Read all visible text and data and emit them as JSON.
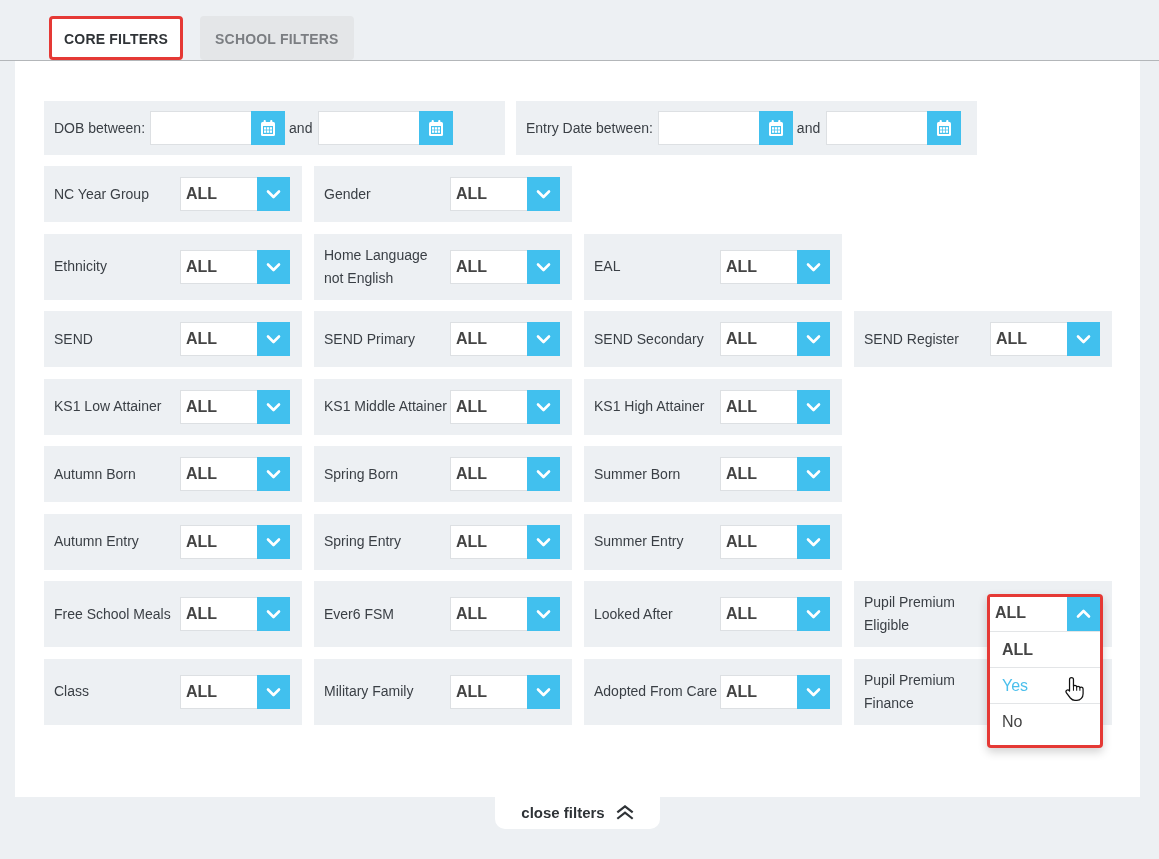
{
  "tabs": [
    {
      "label": "CORE FILTERS",
      "selected": true,
      "highlighted": true
    },
    {
      "label": "SCHOOL FILTERS",
      "selected": false,
      "highlighted": false
    }
  ],
  "date_filters": [
    {
      "label": "DOB between:",
      "joiner": "and"
    },
    {
      "label": "Entry Date between:",
      "joiner": "and"
    }
  ],
  "filter_rows": [
    [
      {
        "label": "NC Year Group",
        "value": "ALL",
        "expanded": false
      },
      {
        "label": "Gender",
        "value": "ALL",
        "expanded": false
      }
    ],
    [
      {
        "label": "Ethnicity",
        "value": "ALL",
        "expanded": false
      },
      {
        "label": "Home Language not English",
        "value": "ALL",
        "expanded": false
      },
      {
        "label": "EAL",
        "value": "ALL",
        "expanded": false
      }
    ],
    [
      {
        "label": "SEND",
        "value": "ALL",
        "expanded": false
      },
      {
        "label": "SEND Primary",
        "value": "ALL",
        "expanded": false
      },
      {
        "label": "SEND Secondary",
        "value": "ALL",
        "expanded": false
      },
      {
        "label": "SEND Register",
        "value": "ALL",
        "expanded": false
      }
    ],
    [
      {
        "label": "KS1 Low Attainer",
        "value": "ALL",
        "expanded": false
      },
      {
        "label": "KS1 Middle Attainer",
        "value": "ALL",
        "expanded": false
      },
      {
        "label": "KS1 High Attainer",
        "value": "ALL",
        "expanded": false
      }
    ],
    [
      {
        "label": "Autumn Born",
        "value": "ALL",
        "expanded": false
      },
      {
        "label": "Spring Born",
        "value": "ALL",
        "expanded": false
      },
      {
        "label": "Summer Born",
        "value": "ALL",
        "expanded": false
      }
    ],
    [
      {
        "label": "Autumn Entry",
        "value": "ALL",
        "expanded": false
      },
      {
        "label": "Spring Entry",
        "value": "ALL",
        "expanded": false
      },
      {
        "label": "Summer Entry",
        "value": "ALL",
        "expanded": false
      }
    ],
    [
      {
        "label": "Free School Meals",
        "value": "ALL",
        "expanded": false
      },
      {
        "label": "Ever6 FSM",
        "value": "ALL",
        "expanded": false
      },
      {
        "label": "Looked After",
        "value": "ALL",
        "expanded": false
      },
      {
        "label": "Pupil Premium Eligible",
        "value": "ALL",
        "expanded": true,
        "dropdown": {
          "highlighted": true,
          "options": [
            {
              "label": "ALL",
              "selected": true,
              "hovered": false
            },
            {
              "label": "Yes",
              "selected": false,
              "hovered": true
            },
            {
              "label": "No",
              "selected": false,
              "hovered": false
            }
          ]
        }
      }
    ],
    [
      {
        "label": "Class",
        "value": "ALL",
        "expanded": false
      },
      {
        "label": "Military Family",
        "value": "ALL",
        "expanded": false
      },
      {
        "label": "Adopted From Care",
        "value": "ALL",
        "expanded": false
      },
      {
        "label": "Pupil Premium Finance"
      }
    ]
  ],
  "close_button": {
    "label": "close filters"
  }
}
